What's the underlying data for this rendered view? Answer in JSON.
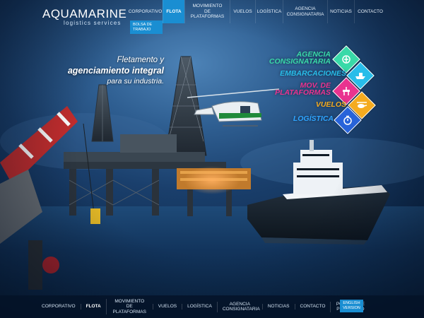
{
  "brand": {
    "logo_main": "AQUAMARINE",
    "logo_sub": "logistics services"
  },
  "topnav": {
    "items": [
      {
        "label": "Corporativo"
      },
      {
        "label": "Flota",
        "active": true
      },
      {
        "label": "Movimiento de Plataformas"
      },
      {
        "label": "Vuelos"
      },
      {
        "label": "Logística"
      },
      {
        "label": "Agencia Consignataria"
      },
      {
        "label": "Noticias"
      },
      {
        "label": "Contacto"
      }
    ],
    "submenu": {
      "label": "Bolsa de Trabajo"
    }
  },
  "hero": {
    "slogan_line1": "Fletamento y",
    "slogan_line2": "agenciamiento integral",
    "slogan_line3": "para su industria."
  },
  "services": [
    {
      "label": "Agencia Consignataria",
      "color": "#39d9a8",
      "icon": "anchor-icon"
    },
    {
      "label": "Embarcaciones",
      "color": "#28bde9",
      "icon": "ship-icon"
    },
    {
      "label": "Mov. de Plataformas",
      "color": "#e9338f",
      "icon": "platform-icon"
    },
    {
      "label": "Vuelos",
      "color": "#f5ab1f",
      "icon": "helicopter-icon"
    },
    {
      "label": "Logística",
      "color": "#2863d9",
      "icon": "stopwatch-icon"
    }
  ],
  "footer": {
    "items": [
      {
        "label": "Corporativo"
      },
      {
        "label": "Flota",
        "active": true
      },
      {
        "label": "Movimiento de Plataformas"
      },
      {
        "label": "Vuelos"
      },
      {
        "label": "Logística"
      },
      {
        "label": "Agencia Consignataria"
      },
      {
        "label": "Noticias"
      },
      {
        "label": "Contacto"
      },
      {
        "label": "Política de Privacidad"
      }
    ],
    "english_button": "English Version"
  },
  "colors": {
    "accent": "#1a8ed2",
    "background": "#0c2a4c"
  }
}
